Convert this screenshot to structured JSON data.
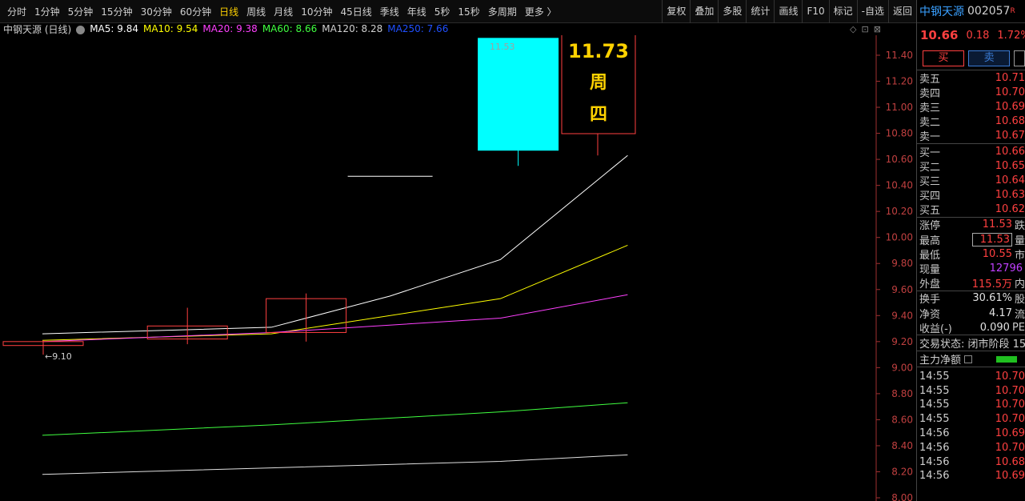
{
  "toolbar": {
    "tabs": [
      {
        "label": "分时",
        "active": false
      },
      {
        "label": "1分钟",
        "active": false
      },
      {
        "label": "5分钟",
        "active": false
      },
      {
        "label": "15分钟",
        "active": false
      },
      {
        "label": "30分钟",
        "active": false
      },
      {
        "label": "60分钟",
        "active": false
      },
      {
        "label": "日线",
        "active": true
      },
      {
        "label": "周线",
        "active": false
      },
      {
        "label": "月线",
        "active": false
      },
      {
        "label": "10分钟",
        "active": false
      },
      {
        "label": "45日线",
        "active": false
      },
      {
        "label": "季线",
        "active": false
      },
      {
        "label": "年线",
        "active": false
      },
      {
        "label": "5秒",
        "active": false
      },
      {
        "label": "15秒",
        "active": false
      },
      {
        "label": "多周期",
        "active": false
      },
      {
        "label": "更多 〉",
        "active": false
      }
    ],
    "tools": [
      "复权",
      "叠加",
      "多股",
      "统计",
      "画线",
      "F10",
      "标记",
      "-自选",
      "返回"
    ]
  },
  "legend": {
    "name": "中钢天源 (日线)",
    "mas": [
      {
        "label": "MA5: 9.84",
        "color": "#ffffff"
      },
      {
        "label": "MA10: 9.54",
        "color": "#ffff00"
      },
      {
        "label": "MA20: 9.38",
        "color": "#ff40ff"
      },
      {
        "label": "MA60: 8.66",
        "color": "#40ff40"
      },
      {
        "label": "MA120: 8.28",
        "color": "#d0d0d0"
      },
      {
        "label": "MA250: 7.66",
        "color": "#2050ff"
      }
    ]
  },
  "chart_icons": [
    "◇",
    "⊡",
    "⊠"
  ],
  "chart_data": {
    "type": "line",
    "title": "中钢天源 (日线)",
    "yticks": [
      "11.40",
      "11.20",
      "11.00",
      "10.80",
      "10.60",
      "10.40",
      "10.20",
      "10.00",
      "9.80",
      "9.60",
      "9.40",
      "9.20",
      "9.00",
      "8.80",
      "8.60",
      "8.40",
      "8.20",
      "8.00"
    ],
    "ylim": [
      8.0,
      11.53
    ],
    "candles": [
      {
        "x": 0,
        "open": 9.17,
        "close": 9.2,
        "high": 9.21,
        "low": 9.1,
        "color": "#ff4040",
        "hollow": true
      },
      {
        "x": 1.7,
        "open": 9.22,
        "close": 9.32,
        "high": 9.46,
        "low": 9.18,
        "color": "#ff4040",
        "hollow": true
      },
      {
        "x": 3.1,
        "open": 9.27,
        "close": 9.53,
        "high": 9.57,
        "low": 9.2,
        "color": "#ff4040",
        "hollow": true
      },
      {
        "x": 5.6,
        "open": 11.53,
        "close": 10.67,
        "high": 11.53,
        "low": 10.55,
        "color": "#00ffff",
        "hollow": false
      }
    ],
    "annotations": {
      "low_label": "←9.10",
      "high_label": "11.53",
      "callout_price": "11.73",
      "callout_day": [
        "周",
        "四"
      ]
    },
    "series": [
      {
        "name": "MA5",
        "color": "#ffffff",
        "points": [
          [
            0.5,
            9.26
          ],
          [
            3.2,
            9.31
          ],
          [
            4.6,
            9.55
          ],
          [
            5.9,
            9.83
          ],
          [
            7.4,
            10.63
          ]
        ]
      },
      {
        "name": "MA10",
        "color": "#ffff00",
        "points": [
          [
            0.5,
            9.21
          ],
          [
            3.2,
            9.26
          ],
          [
            5.9,
            9.53
          ],
          [
            7.4,
            9.94
          ]
        ]
      },
      {
        "name": "MA20",
        "color": "#ff40ff",
        "points": [
          [
            0.5,
            9.2
          ],
          [
            3.2,
            9.27
          ],
          [
            5.9,
            9.38
          ],
          [
            7.4,
            9.56
          ]
        ]
      },
      {
        "name": "MA60",
        "color": "#40ff40",
        "points": [
          [
            0.5,
            8.48
          ],
          [
            3.2,
            8.56
          ],
          [
            5.9,
            8.66
          ],
          [
            7.4,
            8.73
          ]
        ]
      },
      {
        "name": "MA120",
        "color": "#e0e0e0",
        "points": [
          [
            0.5,
            8.18
          ],
          [
            3.2,
            8.23
          ],
          [
            5.9,
            8.28
          ],
          [
            7.4,
            8.33
          ]
        ]
      }
    ],
    "dash_segment": {
      "x0": 4.1,
      "x1": 5.1,
      "y": 10.47
    }
  },
  "quote": {
    "name": "中钢天源",
    "code": "002057",
    "flag": "R",
    "last": "10.66",
    "change": "0.18",
    "pct": "1.72%",
    "buy_label": "买",
    "sell_label": "卖"
  },
  "orderbook": {
    "asks": [
      {
        "label": "卖五",
        "price": "10.71"
      },
      {
        "label": "卖四",
        "price": "10.70"
      },
      {
        "label": "卖三",
        "price": "10.69"
      },
      {
        "label": "卖二",
        "price": "10.68"
      },
      {
        "label": "卖一",
        "price": "10.67"
      }
    ],
    "bids": [
      {
        "label": "买一",
        "price": "10.66"
      },
      {
        "label": "买二",
        "price": "10.65"
      },
      {
        "label": "买三",
        "price": "10.64"
      },
      {
        "label": "买四",
        "price": "10.63"
      },
      {
        "label": "买五",
        "price": "10.62"
      }
    ]
  },
  "stats1": [
    {
      "label": "涨停",
      "value": "11.53",
      "cls": "red",
      "extra": "跌"
    },
    {
      "label": "最高",
      "value": "11.53",
      "cls": "red boxed",
      "extra": "量"
    },
    {
      "label": "最低",
      "value": "10.55",
      "cls": "red",
      "extra": "市"
    },
    {
      "label": "现量",
      "value": "12796",
      "cls": "purple",
      "extra": ""
    },
    {
      "label": "外盘",
      "value": "115.5万",
      "cls": "red",
      "extra": "内"
    }
  ],
  "stats2": [
    {
      "label": "换手",
      "value": "30.61%",
      "cls": "white",
      "extra": "股"
    },
    {
      "label": "净资",
      "value": "4.17",
      "cls": "white",
      "extra": "流"
    },
    {
      "label": "收益(-)",
      "value": "0.090",
      "cls": "white",
      "extra": "PE"
    }
  ],
  "status": "交易状态: 闭市阶段 15",
  "flow_label": "主力净额",
  "ticks": [
    {
      "time": "14:55",
      "price": "10.70"
    },
    {
      "time": "14:55",
      "price": "10.70"
    },
    {
      "time": "14:55",
      "price": "10.70"
    },
    {
      "time": "14:55",
      "price": "10.70"
    },
    {
      "time": "14:56",
      "price": "10.69"
    },
    {
      "time": "14:56",
      "price": "10.70"
    },
    {
      "time": "14:56",
      "price": "10.68"
    },
    {
      "time": "14:56",
      "price": "10.69"
    }
  ]
}
